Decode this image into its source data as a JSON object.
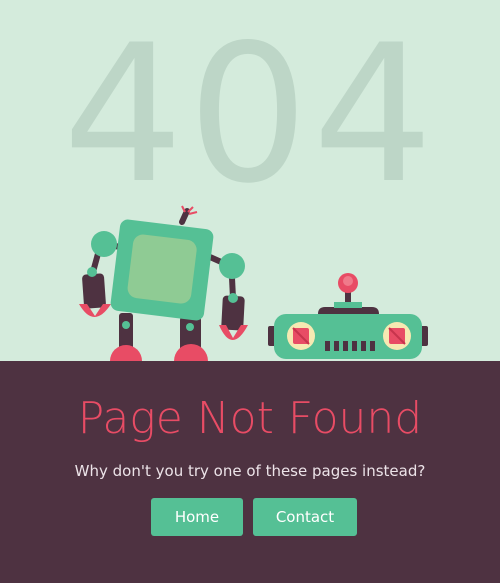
{
  "hero": {
    "error_code": "404"
  },
  "message": {
    "title": "Page Not Found",
    "subtitle": "Why don't you try one of these pages instead?"
  },
  "buttons": {
    "home_label": "Home",
    "contact_label": "Contact"
  },
  "colors": {
    "sky": "#d4ebdc",
    "big_text": "#bdd6c7",
    "ground": "#4e3241",
    "accent_red": "#e84c65",
    "robot_green": "#55c095",
    "button_green": "#55c095"
  },
  "illustration": {
    "icons": [
      "standing-robot-icon",
      "fallen-robot-icon"
    ]
  }
}
